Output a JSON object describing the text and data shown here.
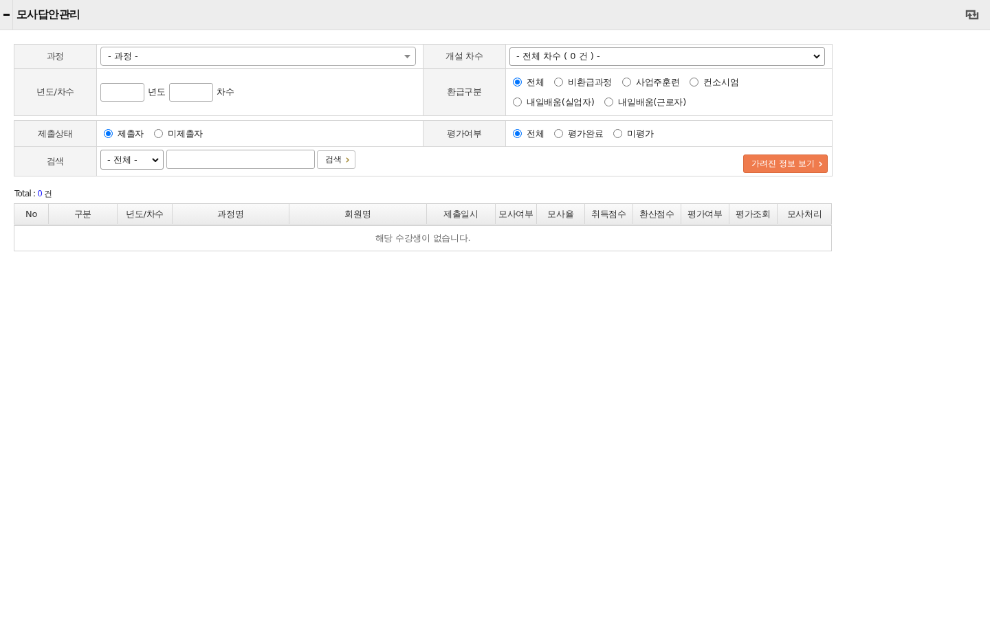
{
  "header": {
    "title": "모사답안관리"
  },
  "filters": {
    "course": {
      "label": "과정",
      "value": "- 과정 -"
    },
    "session": {
      "label": "개설 차수",
      "value": "- 전체 차수 ( 0 건 ) -"
    },
    "year_round": {
      "label": "년도/차수",
      "year_suffix": "년도",
      "round_suffix": "차수"
    },
    "refund_type": {
      "label": "환급구분",
      "rows": [
        {
          "options": [
            {
              "label": "전체",
              "selected": true
            },
            {
              "label": "비환급과정",
              "selected": false
            },
            {
              "label": "사업주훈련",
              "selected": false
            },
            {
              "label": "컨소시엄",
              "selected": false
            }
          ]
        },
        {
          "options": [
            {
              "label": "내일배움(실업자)",
              "selected": false
            },
            {
              "label": "내일배움(근로자)",
              "selected": false
            }
          ]
        }
      ]
    },
    "submission_status": {
      "label": "제출상태",
      "options": [
        {
          "label": "제출자",
          "selected": true
        },
        {
          "label": "미제출자",
          "selected": false
        }
      ]
    },
    "evaluation": {
      "label": "평가여부",
      "options": [
        {
          "label": "전체",
          "selected": true
        },
        {
          "label": "평가완료",
          "selected": false
        },
        {
          "label": "미평가",
          "selected": false
        }
      ]
    },
    "search": {
      "label": "검색",
      "field": "- 전체 -",
      "button": "검색",
      "reveal_button": "가려진 정보 보기"
    }
  },
  "total": {
    "label": "Total :",
    "count": "0",
    "unit": "건"
  },
  "table": {
    "columns": [
      "No",
      "구분",
      "년도/차수",
      "과정명",
      "회원명",
      "제출일시",
      "모사여부",
      "모사율",
      "취득점수",
      "환산점수",
      "평가여부",
      "평가조회",
      "모사처리"
    ],
    "empty_message": "해당 수강생이 없습니다."
  }
}
